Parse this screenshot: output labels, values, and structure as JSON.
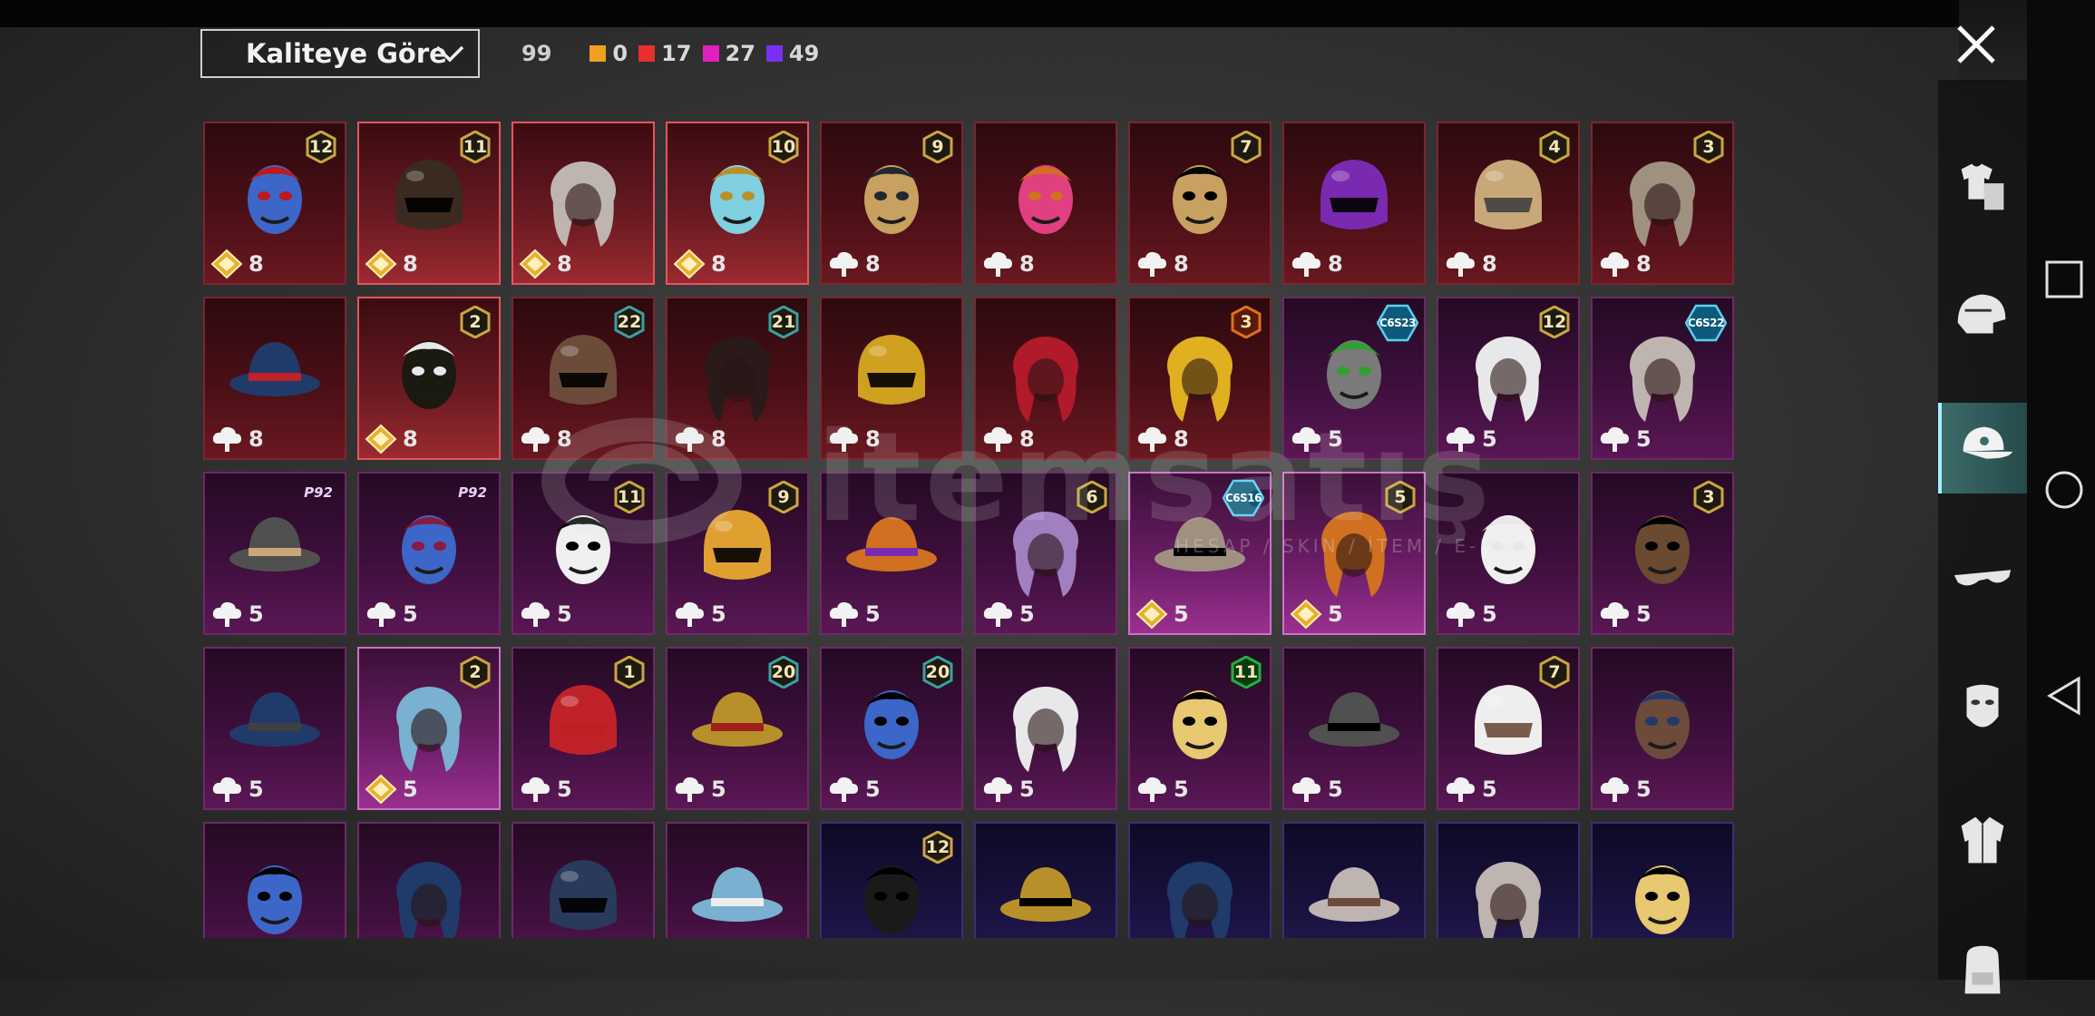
{
  "sort": {
    "label": "Kaliteye Göre"
  },
  "counts": {
    "total": "99",
    "items": [
      {
        "color": "#f0a020",
        "value": "0"
      },
      {
        "color": "#e83030",
        "value": "17"
      },
      {
        "color": "#e020c0",
        "value": "27"
      },
      {
        "color": "#7a30f0",
        "value": "49"
      }
    ]
  },
  "watermark": {
    "brand": "itemsatış",
    "tagline": "HESAP / SKIN / İTEM / E-PIN"
  },
  "tiles": [
    {
      "rarity": "red",
      "icon": "pale-hair-bun",
      "badge": "12",
      "points": "8",
      "pt": "gold"
    },
    {
      "rarity": "red sel",
      "icon": "black-slick-hair",
      "badge": "11",
      "points": "8",
      "pt": "gold"
    },
    {
      "rarity": "red sel",
      "icon": "white-ghost-hair",
      "badge": "",
      "points": "8",
      "pt": "gold"
    },
    {
      "rarity": "red sel",
      "icon": "brown-braided-hair",
      "badge": "10",
      "points": "8",
      "pt": "gold"
    },
    {
      "rarity": "red",
      "icon": "zombie-head",
      "badge": "9",
      "points": "8",
      "pt": "cloud"
    },
    {
      "rarity": "red",
      "icon": "white-cowboy-hat",
      "badge": "",
      "points": "8",
      "pt": "cloud"
    },
    {
      "rarity": "red",
      "icon": "silver-long-hair",
      "badge": "7",
      "points": "8",
      "pt": "cloud"
    },
    {
      "rarity": "red",
      "icon": "red-helmet",
      "badge": "",
      "points": "8",
      "pt": "cloud"
    },
    {
      "rarity": "red",
      "icon": "snowman-top-hat",
      "badge": "4",
      "points": "8",
      "pt": "cloud"
    },
    {
      "rarity": "red",
      "icon": "clown-blue-curls",
      "badge": "3",
      "points": "8",
      "pt": "cloud"
    },
    {
      "rarity": "red",
      "icon": "teal-dragon-helmet",
      "badge": "",
      "points": "8",
      "pt": "cloud"
    },
    {
      "rarity": "red sel",
      "icon": "blue-bucket-hat",
      "badge": "2",
      "points": "8",
      "pt": "gold"
    },
    {
      "rarity": "red",
      "icon": "golden-pharaoh-helmet",
      "badge": "22",
      "badge_style": "teal",
      "points": "8",
      "pt": "cloud"
    },
    {
      "rarity": "red",
      "icon": "silver-haired-mask",
      "badge": "21",
      "badge_style": "teal",
      "points": "8",
      "pt": "cloud"
    },
    {
      "rarity": "red",
      "icon": "oni-fox-mask",
      "badge": "",
      "points": "8",
      "pt": "cloud"
    },
    {
      "rarity": "red",
      "icon": "black-batlike-helmet",
      "badge": "",
      "points": "8",
      "pt": "cloud"
    },
    {
      "rarity": "red",
      "icon": "fries-box-head",
      "badge": "3",
      "badge_style": "orange",
      "points": "8",
      "pt": "cloud"
    },
    {
      "rarity": "pink",
      "icon": "cat-ear-headphones",
      "badge": "C6S23",
      "badge_style": "series",
      "points": "5",
      "pt": "cloud"
    },
    {
      "rarity": "pink",
      "icon": "orange-long-hair",
      "badge": "12",
      "points": "5",
      "pt": "cloud"
    },
    {
      "rarity": "pink",
      "icon": "purple-short-hair",
      "badge": "C6S22",
      "badge_style": "series",
      "points": "5",
      "pt": "cloud"
    },
    {
      "rarity": "pink",
      "icon": "red-bob-hair",
      "badge": "P92",
      "badge_style": "tag",
      "points": "5",
      "pt": "cloud"
    },
    {
      "rarity": "pink",
      "icon": "panda-mask",
      "badge": "P92",
      "badge_style": "tag",
      "points": "5",
      "pt": "cloud"
    },
    {
      "rarity": "pink",
      "icon": "flower-veil-hair",
      "badge": "11",
      "points": "5",
      "pt": "cloud"
    },
    {
      "rarity": "pink",
      "icon": "dark-ponytail",
      "badge": "9",
      "points": "5",
      "pt": "cloud"
    },
    {
      "rarity": "pink",
      "icon": "red-eyed-mask",
      "badge": "",
      "points": "5",
      "pt": "cloud"
    },
    {
      "rarity": "pink",
      "icon": "gold-visor-helmet",
      "badge": "6",
      "points": "5",
      "pt": "cloud"
    },
    {
      "rarity": "pink sel",
      "icon": "red-wavy-hair",
      "badge": "C6S16",
      "badge_style": "series",
      "points": "5",
      "pt": "gold"
    },
    {
      "rarity": "pink sel",
      "icon": "bow-brown-hair",
      "badge": "5",
      "points": "5",
      "pt": "gold"
    },
    {
      "rarity": "pink",
      "icon": "silver-braids",
      "badge": "",
      "points": "5",
      "pt": "cloud"
    },
    {
      "rarity": "pink",
      "icon": "jester-hat",
      "badge": "3",
      "points": "5",
      "pt": "cloud"
    },
    {
      "rarity": "pink",
      "icon": "black-lace-hair",
      "badge": "",
      "points": "5",
      "pt": "cloud"
    },
    {
      "rarity": "pink sel",
      "icon": "blonde-cap-hair",
      "badge": "2",
      "points": "5",
      "pt": "gold"
    },
    {
      "rarity": "pink",
      "icon": "pastel-pigtails",
      "badge": "1",
      "points": "5",
      "pt": "cloud"
    },
    {
      "rarity": "pink",
      "icon": "bunny-blonde-hair",
      "badge": "20",
      "badge_style": "teal",
      "points": "5",
      "pt": "cloud"
    },
    {
      "rarity": "pink",
      "icon": "gold-trim-helmet",
      "badge": "20",
      "badge_style": "teal",
      "points": "5",
      "pt": "cloud"
    },
    {
      "rarity": "pink",
      "icon": "duck-head",
      "badge": "",
      "points": "5",
      "pt": "cloud"
    },
    {
      "rarity": "pink",
      "icon": "blue-cap-dreads",
      "badge": "11",
      "badge_style": "green",
      "points": "5",
      "pt": "cloud"
    },
    {
      "rarity": "pink",
      "icon": "horned-ninja-mask",
      "badge": "",
      "points": "5",
      "pt": "cloud"
    },
    {
      "rarity": "pink",
      "icon": "crowned-veil",
      "badge": "7",
      "points": "5",
      "pt": "cloud"
    },
    {
      "rarity": "pink",
      "icon": "red-braid-hair",
      "badge": "",
      "points": "5",
      "pt": "cloud"
    },
    {
      "rarity": "pink",
      "icon": "wolf-mask",
      "badge": "",
      "points": "",
      "pt": ""
    },
    {
      "rarity": "pink",
      "icon": "goggle-hood",
      "badge": "",
      "points": "",
      "pt": ""
    },
    {
      "rarity": "pink",
      "icon": "frog-cap",
      "badge": "",
      "points": "",
      "pt": ""
    },
    {
      "rarity": "pink",
      "icon": "orange-visor-helmet",
      "badge": "",
      "points": "",
      "pt": ""
    },
    {
      "rarity": "purple",
      "icon": "bunny-ear-helmet",
      "badge": "12",
      "points": "",
      "pt": ""
    },
    {
      "rarity": "purple",
      "icon": "pink-cat-beanie",
      "badge": "",
      "points": "",
      "pt": ""
    },
    {
      "rarity": "purple",
      "icon": "blue-baseball-cap",
      "badge": "",
      "points": "",
      "pt": ""
    },
    {
      "rarity": "purple",
      "icon": "gas-mask-helmet",
      "badge": "",
      "points": "",
      "pt": ""
    },
    {
      "rarity": "purple",
      "icon": "gold-visor-motor-helmet",
      "badge": "",
      "points": "",
      "pt": ""
    },
    {
      "rarity": "purple",
      "icon": "safari-bunny-hat",
      "badge": "",
      "points": "",
      "pt": ""
    }
  ],
  "side_tabs": [
    {
      "icon": "outfit-icon",
      "active": false
    },
    {
      "icon": "helmet-icon",
      "active": false
    },
    {
      "icon": "cap-icon",
      "active": true
    },
    {
      "icon": "sunglasses-icon",
      "active": false
    },
    {
      "icon": "face-mask-icon",
      "active": false
    },
    {
      "icon": "jacket-icon",
      "active": false
    },
    {
      "icon": "backpack-icon",
      "active": false
    }
  ],
  "system_nav": [
    "recent-apps-icon",
    "home-icon",
    "back-icon"
  ]
}
